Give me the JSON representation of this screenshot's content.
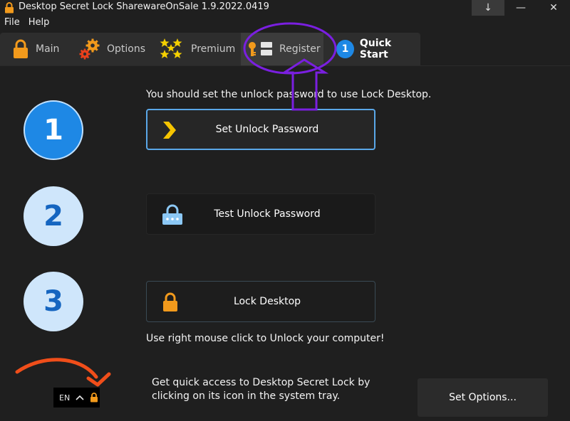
{
  "window": {
    "title": "Desktop Secret Lock SharewareOnSale 1.9.2022.0419",
    "minimize_glyph": "—",
    "close_glyph": "✕",
    "extra_glyph": "↓"
  },
  "menu": {
    "items": [
      {
        "label": "File"
      },
      {
        "label": "Help"
      }
    ]
  },
  "tabs": {
    "main": {
      "label": "Main",
      "icon": "lock-icon"
    },
    "options": {
      "label": "Options",
      "icon": "gears-icon"
    },
    "premium": {
      "label": "Premium",
      "icon": "stars-icon"
    },
    "register": {
      "label": "Register",
      "icon": "key-icon"
    },
    "quick_start": {
      "label": "Quick Start",
      "badge": "1"
    }
  },
  "steps": [
    {
      "number": "1"
    },
    {
      "number": "2"
    },
    {
      "number": "3"
    }
  ],
  "hints": {
    "top": "You should set the unlock password to use Lock Desktop.",
    "bottom": "Use right mouse click to Unlock your computer!"
  },
  "actions": {
    "set_password": {
      "label": "Set Unlock Password",
      "icon": "chevron-right-icon"
    },
    "test_password": {
      "label": "Test Unlock Password",
      "icon": "lock-password-icon"
    },
    "lock_desktop": {
      "label": "Lock Desktop",
      "icon": "lock-icon"
    }
  },
  "tray": {
    "lang": "EN",
    "text_line1": "Get quick access to Desktop Secret Lock by",
    "text_line2": "clicking on its icon in the system tray."
  },
  "set_options": {
    "label": "Set Options..."
  },
  "colors": {
    "accent_blue": "#1e88e5",
    "lock_orange": "#f29a1c",
    "star_yellow": "#f5d000",
    "annotation_purple": "#7a1fe0",
    "annotation_orange": "#f04e1a"
  }
}
